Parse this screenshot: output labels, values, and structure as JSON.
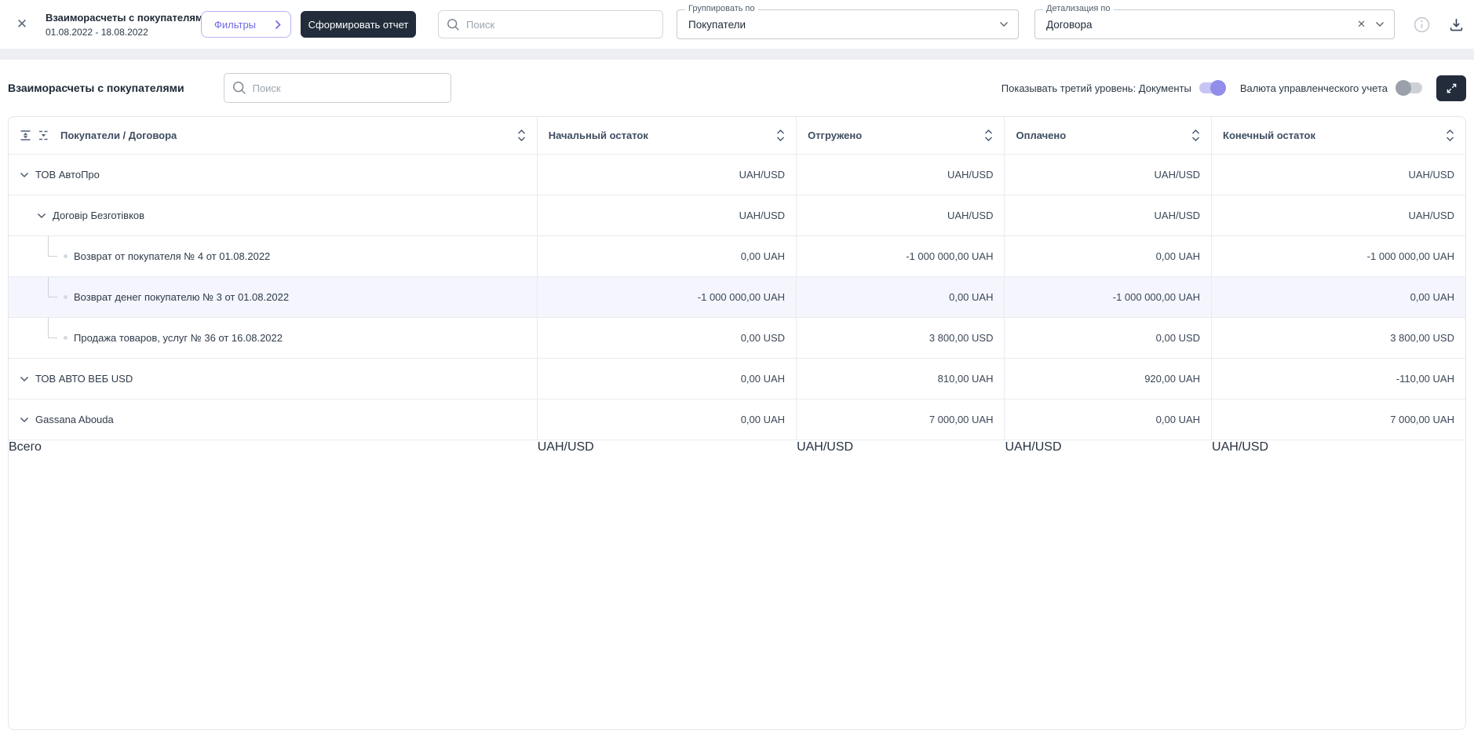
{
  "topbar": {
    "title": "Взаиморасчеты с покупателями",
    "date_range": "01.08.2022 - 18.08.2022",
    "filters_label": "Фильтры",
    "generate_report_label": "Сформировать отчет",
    "search_placeholder": "Поиск",
    "group_by": {
      "label": "Группировать по",
      "value": "Покупатели"
    },
    "detail_by": {
      "label": "Детализация по",
      "value": "Договора"
    }
  },
  "report": {
    "title": "Взаиморасчеты с покупателями",
    "search_placeholder": "Поиск",
    "toggles": {
      "third_level": {
        "label": "Показывать третий уровень: Документы",
        "state": "on"
      },
      "management_currency": {
        "label": "Валюта управленческого учета",
        "state": "off"
      }
    }
  },
  "table": {
    "columns": [
      "Покупатели / Договора",
      "Начальный остаток",
      "Отгружено",
      "Оплачено",
      "Конечный остаток"
    ],
    "rows": [
      {
        "level": 1,
        "expanded": true,
        "label": "ТОВ АвтоПро",
        "values": [
          "UAH/USD",
          "UAH/USD",
          "UAH/USD",
          "UAH/USD"
        ]
      },
      {
        "level": 2,
        "expanded": true,
        "label": "Договір Безготівков",
        "values": [
          "UAH/USD",
          "UAH/USD",
          "UAH/USD",
          "UAH/USD"
        ]
      },
      {
        "level": 3,
        "label": "Возврат от покупателя № 4 от 01.08.2022",
        "values": [
          "0,00 UAH",
          "-1 000 000,00 UAH",
          "0,00 UAH",
          "-1 000 000,00 UAH"
        ]
      },
      {
        "level": 3,
        "highlighted": true,
        "label": "Возврат денег покупателю № 3 от 01.08.2022",
        "values": [
          "-1 000 000,00 UAH",
          "0,00 UAH",
          "-1 000 000,00 UAH",
          "0,00 UAH"
        ]
      },
      {
        "level": 3,
        "label": "Продажа товаров, услуг № 36 от 16.08.2022",
        "values": [
          "0,00 USD",
          "3 800,00 USD",
          "0,00 USD",
          "3 800,00 USD"
        ]
      },
      {
        "level": 1,
        "expanded": true,
        "label": "ТОВ АВТО ВЕБ USD",
        "values": [
          "0,00 UAH",
          "810,00 UAH",
          "920,00 UAH",
          "-110,00 UAH"
        ]
      },
      {
        "level": 1,
        "expanded": true,
        "label": "Gassana Abouda",
        "values": [
          "0,00 UAH",
          "7 000,00 UAH",
          "0,00 UAH",
          "7 000,00 UAH"
        ]
      }
    ],
    "total": {
      "label": "Всего",
      "values": [
        "UAH/USD",
        "UAH/USD",
        "UAH/USD",
        "UAH/USD"
      ]
    }
  },
  "colors": {
    "accent_purple": "#6f69e6",
    "toggle_purple_knob": "#918de9",
    "toggle_purple_track": "#c8c4f4",
    "dark_navy": "#222c3b",
    "row_highlight": "#f4f5fd",
    "tree_connector_blue": "#9cc0e8",
    "bottom_bar_dark": "#232e3d",
    "bottom_bar_orange": "#eda73f",
    "border_light": "#e9ebef"
  }
}
